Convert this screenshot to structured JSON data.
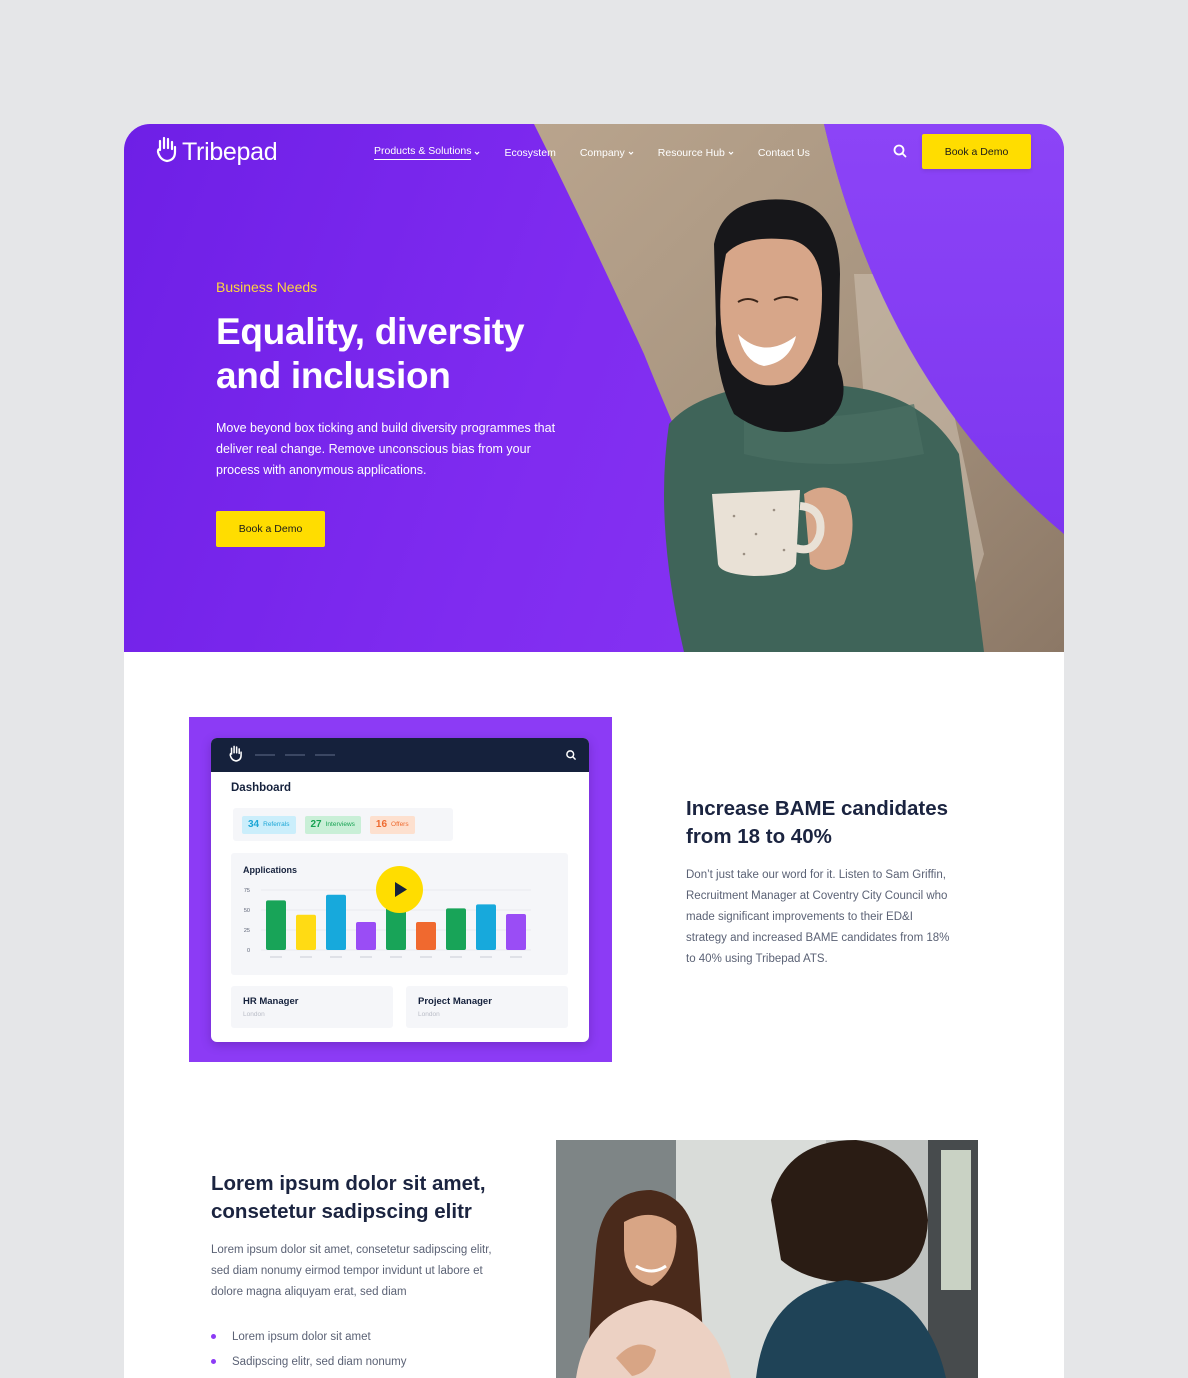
{
  "nav": {
    "logo_text": "Tribepad",
    "items": [
      {
        "label": "Products & Solutions",
        "has_dropdown": true,
        "active": true
      },
      {
        "label": "Ecosystem",
        "has_dropdown": false
      },
      {
        "label": "Company",
        "has_dropdown": true
      },
      {
        "label": "Resource Hub",
        "has_dropdown": true
      },
      {
        "label": "Contact Us",
        "has_dropdown": false
      }
    ],
    "cta": "Book a Demo"
  },
  "hero": {
    "eyebrow": "Business Needs",
    "title": "Equality, diversity and inclusion",
    "description": "Move beyond box ticking and build diversity programmes that deliver real change. Remove unconscious bias from your process with anonymous applications.",
    "cta": "Book a Demo"
  },
  "dashboard": {
    "title": "Dashboard",
    "stats": [
      {
        "value": "34",
        "label": "Referrals"
      },
      {
        "value": "27",
        "label": "Interviews"
      },
      {
        "value": "16",
        "label": "Offers"
      }
    ],
    "chart_data": {
      "type": "bar",
      "title": "Applications",
      "y_ticks": [
        "75",
        "50",
        "25",
        "0"
      ],
      "ylim": [
        0,
        75
      ],
      "values": [
        62,
        44,
        69,
        35,
        74,
        35,
        52,
        57,
        45
      ],
      "colors": [
        "#18a458",
        "#ffdb14",
        "#17a9dc",
        "#9a4df5",
        "#18a458",
        "#f0692f",
        "#18a458",
        "#17a9dc",
        "#9a4df5"
      ]
    },
    "jobs": [
      {
        "title": "HR Manager",
        "location": "London"
      },
      {
        "title": "Project Manager",
        "location": "London"
      }
    ]
  },
  "section2": {
    "title": "Increase BAME candidates from 18 to 40%",
    "description": "Don’t just take our word for it. Listen to Sam Griffin, Recruitment Manager at Coventry City Council who made significant improvements to their ED&I strategy and increased BAME candidates from 18% to 40% using Tribepad ATS."
  },
  "section3": {
    "title": "Lorem ipsum dolor sit amet, consetetur sadipscing elitr",
    "description": "Lorem ipsum dolor sit amet, consetetur sadipscing elitr, sed diam nonumy eirmod tempor invidunt ut labore et dolore magna aliquyam erat, sed diam",
    "bullets": [
      "Lorem ipsum dolor sit amet",
      "Sadipscing elitr, sed diam nonumy"
    ]
  },
  "colors": {
    "brand_purple": "#7b2ff0",
    "accent_yellow": "#ffdd00",
    "eyebrow_yellow": "#ffd53d",
    "navy": "#15213c"
  },
  "icons": [
    "hand-logo-icon",
    "chevron-down-icon",
    "search-icon",
    "play-icon"
  ]
}
